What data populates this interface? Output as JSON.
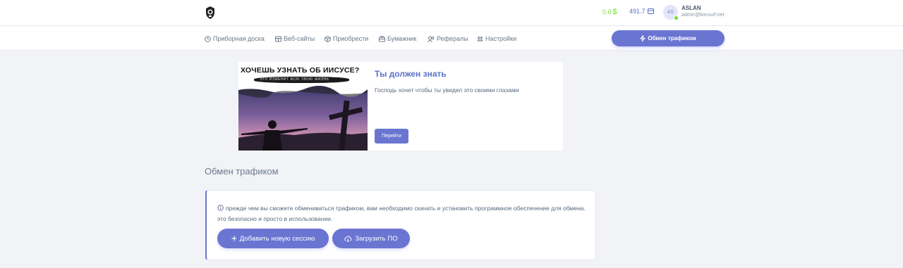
{
  "header": {
    "balance_usd": "0.0",
    "currency_symbol": "$",
    "balance_points": "491.7",
    "user": {
      "initials": "AS",
      "name": "ASLAN",
      "email": "admin@lionsurf.net"
    }
  },
  "nav": {
    "items": [
      {
        "label": "Приборная доска",
        "icon": "dashboard-icon"
      },
      {
        "label": "Веб-сайты",
        "icon": "websites-icon"
      },
      {
        "label": "Приобрести",
        "icon": "box-icon"
      },
      {
        "label": "Бумажник",
        "icon": "wallet-icon"
      },
      {
        "label": "Рефералы",
        "icon": "users-icon"
      },
      {
        "label": "Настройки",
        "icon": "settings-icon"
      }
    ],
    "exchange_button": "Обмен трафиком"
  },
  "promo": {
    "image_headline": "ХОЧЕШЬ УЗНАТЬ ОБ ИИСУСЕ?",
    "image_subline": "ЭТО ИЗМЕНИТ ВСЮ ТВОЮ ЖИЗНЬ",
    "title": "Ты должен знать",
    "text": "Господь хочет чтобы ты увидел это своими глазами",
    "button": "Перейти"
  },
  "page": {
    "title": "Обмен трафиком"
  },
  "card": {
    "note": "прежде чем вы сможете обмениваться трафиком, вам необходимо скачать и установить программное обеспечение для обмена. это безопасно и просто в использовании.",
    "add_session_button": "Добавить новую сессию",
    "download_button": "Загрузить ПО"
  },
  "colors": {
    "accent": "#6a75d2",
    "success": "#71dd37",
    "background": "#f2f3f6"
  }
}
